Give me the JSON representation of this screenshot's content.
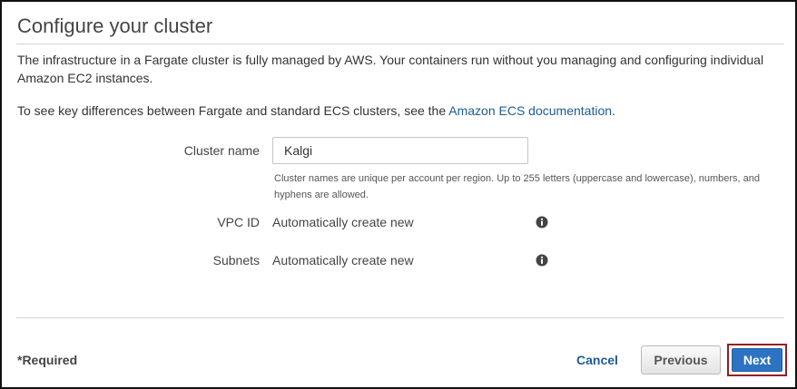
{
  "page": {
    "title": "Configure your cluster",
    "intro": "The infrastructure in a Fargate cluster is fully managed by AWS. Your containers run without you managing and configuring individual Amazon EC2 instances.",
    "differences_text": "To see key differences between Fargate and standard ECS clusters, see the ",
    "differences_link": "Amazon ECS documentation",
    "differences_end": "."
  },
  "form": {
    "cluster_name": {
      "label": "Cluster name",
      "value": "Kalgi",
      "help": "Cluster names are unique per account per region. Up to 255 letters (uppercase and lowercase), numbers, and hyphens are allowed."
    },
    "vpc_id": {
      "label": "VPC ID",
      "value": "Automatically create new",
      "icon": "info-icon"
    },
    "subnets": {
      "label": "Subnets",
      "value": "Automatically create new",
      "icon": "info-icon"
    }
  },
  "footer": {
    "required": "*Required",
    "cancel": "Cancel",
    "previous": "Previous",
    "next": "Next"
  },
  "colors": {
    "link": "#1f5b96",
    "primary_button": "#2e73c1",
    "highlight_border": "#9a1b1f"
  }
}
